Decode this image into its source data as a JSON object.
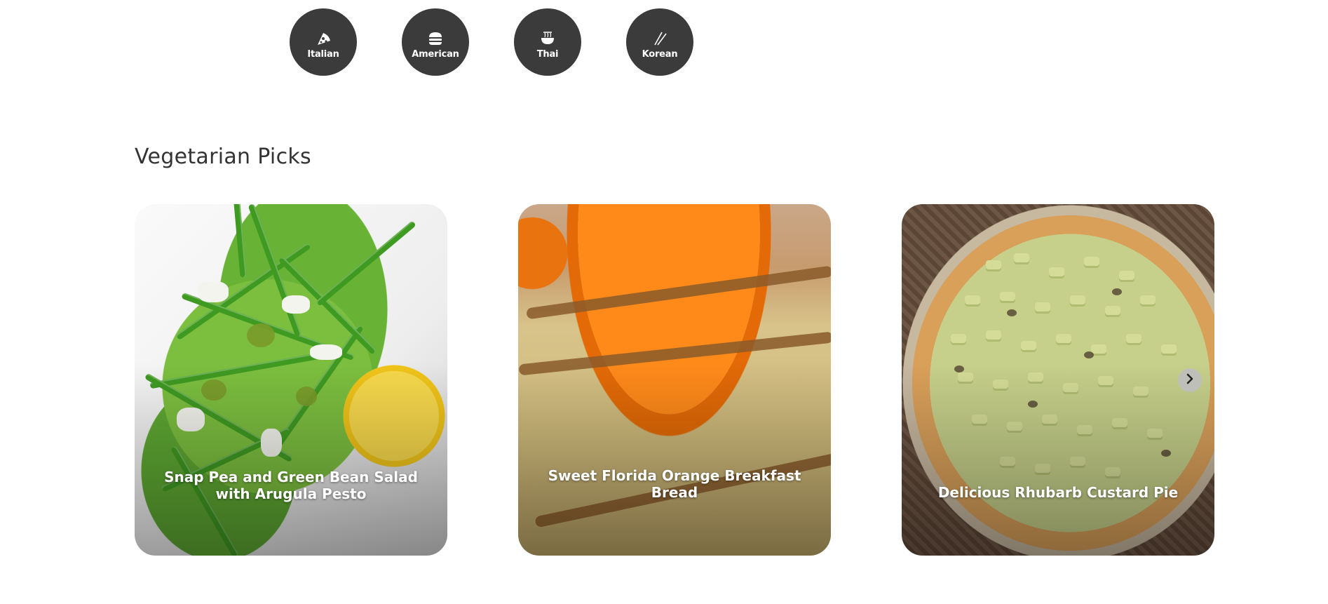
{
  "cuisines": [
    {
      "label": "Italian",
      "icon": "pizza-icon"
    },
    {
      "label": "American",
      "icon": "burger-icon"
    },
    {
      "label": "Thai",
      "icon": "noodle-bowl-icon"
    },
    {
      "label": "Korean",
      "icon": "chopsticks-icon"
    }
  ],
  "section": {
    "title": "Vegetarian Picks"
  },
  "recipes": [
    {
      "title": "Snap Pea and Green Bean Salad with Arugula Pesto"
    },
    {
      "title": "Sweet Florida Orange Breakfast Bread"
    },
    {
      "title": "Delicious Rhubarb Custard Pie"
    }
  ],
  "carousel": {
    "next_icon": "chevron-right-icon"
  },
  "colors": {
    "cuisine_circle": "#3b3b3b",
    "title_text": "#333333"
  }
}
